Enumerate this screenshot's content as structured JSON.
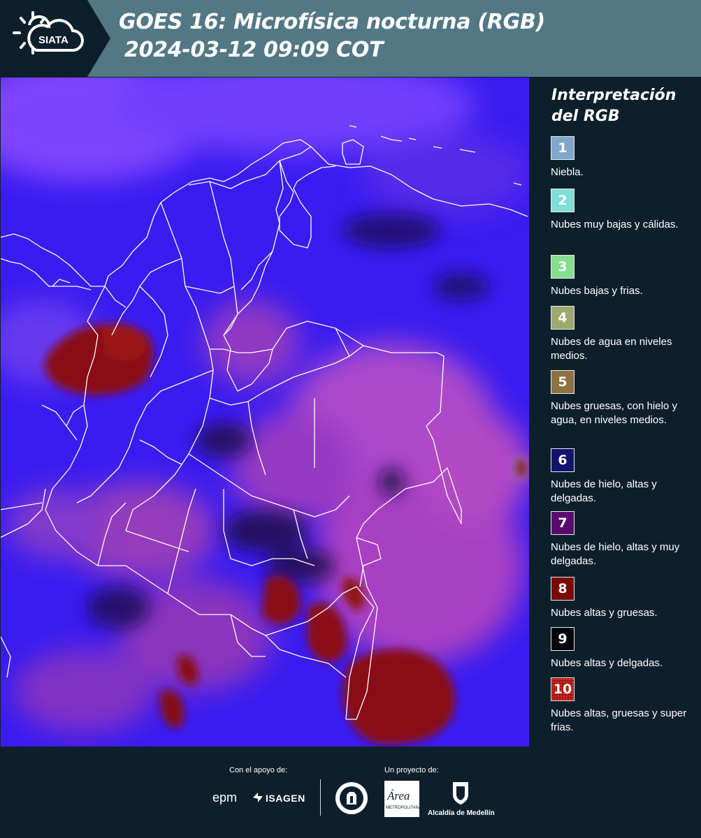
{
  "header": {
    "logo_text": "SIATA",
    "title_line1": "GOES 16: Microfísica nocturna (RGB)",
    "title_line2": "2024-03-12 09:09 COT"
  },
  "legend": {
    "title": "Interpretación del RGB",
    "items": [
      {
        "number": "1",
        "label": "Niebla.",
        "color": "#7fa7cc"
      },
      {
        "number": "2",
        "label": "Nubes muy bajas y cálidas.",
        "color": "#7fded6"
      },
      {
        "number": "3",
        "label": "Nubes bajas y frias.",
        "color": "#86dd8e"
      },
      {
        "number": "4",
        "label": "Nubes de agua en niveles medios.",
        "color": "#9daa6e"
      },
      {
        "number": "5",
        "label": "Nubes gruesas, con hielo y agua, en niveles medios.",
        "color": "#8f7142"
      },
      {
        "number": "6",
        "label": "Nubes de hielo, altas y delgadas.",
        "color": "#12136e"
      },
      {
        "number": "7",
        "label": "Nubes de hielo, altas y muy delgadas.",
        "color": "#5a0a6e"
      },
      {
        "number": "8",
        "label": "Nubes altas y gruesas.",
        "color": "#7a0a0a"
      },
      {
        "number": "9",
        "label": "Nubes altas y delgadas.",
        "color": "#05050c"
      },
      {
        "number": "10",
        "label": "Nubes altas, gruesas y super frias.",
        "color": "#a8150f"
      }
    ]
  },
  "footer": {
    "support_label": "Con el apoyo de:",
    "project_label": "Un proyecto de:",
    "epm": "epm",
    "isagen": "ISAGEN",
    "area_metro": "Área",
    "area_metro_sub": "METROPOLITANA",
    "alcaldia": "Alcaldía de Medellín"
  },
  "colors": {
    "header_bg": "#527885",
    "panel_bg": "#0e1f2c",
    "map_blue": "#3a1cf0",
    "map_magenta": "#b03fc0",
    "map_red": "#8a0f12"
  }
}
